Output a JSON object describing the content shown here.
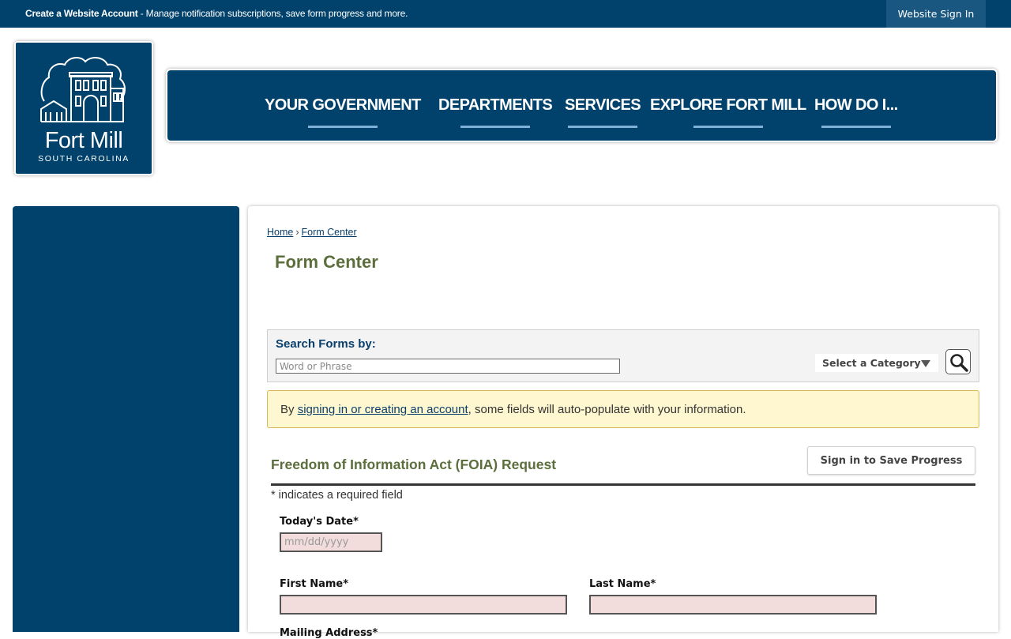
{
  "topbar": {
    "create_account_bold": "Create a Website Account",
    "create_account_text": " - Manage notification subscriptions, save form progress and more.",
    "signin_label": "Website Sign In"
  },
  "logo": {
    "name": "Fort Mill",
    "subtitle": "SOUTH CAROLINA"
  },
  "nav": {
    "items": [
      "YOUR GOVERNMENT",
      "DEPARTMENTS",
      "SERVICES",
      "EXPLORE FORT MILL",
      "HOW DO I..."
    ]
  },
  "breadcrumb": {
    "home": "Home",
    "separator": "›",
    "current": "Form Center"
  },
  "page": {
    "title": "Form Center"
  },
  "search": {
    "label": "Search Forms by:",
    "placeholder": "Word or Phrase",
    "category_label": "Select a Category"
  },
  "notice": {
    "prefix": "By ",
    "link": "signing in or creating an account",
    "suffix": ", some fields will auto-populate with your information."
  },
  "form": {
    "title": "Freedom of Information Act (FOIA) Request",
    "save_button": "Sign in to Save Progress",
    "required_note": "* indicates a required field",
    "fields": {
      "todays_date_label": "Today's Date*",
      "todays_date_placeholder": "mm/dd/yyyy",
      "first_name_label": "First Name*",
      "last_name_label": "Last Name*",
      "mailing_address_label": "Mailing Address*"
    }
  },
  "colors": {
    "brand_navy": "#00426c",
    "title_green": "#5c6e3c",
    "required_field_bg": "#f2dcdc",
    "notice_bg": "#fff7cf"
  }
}
